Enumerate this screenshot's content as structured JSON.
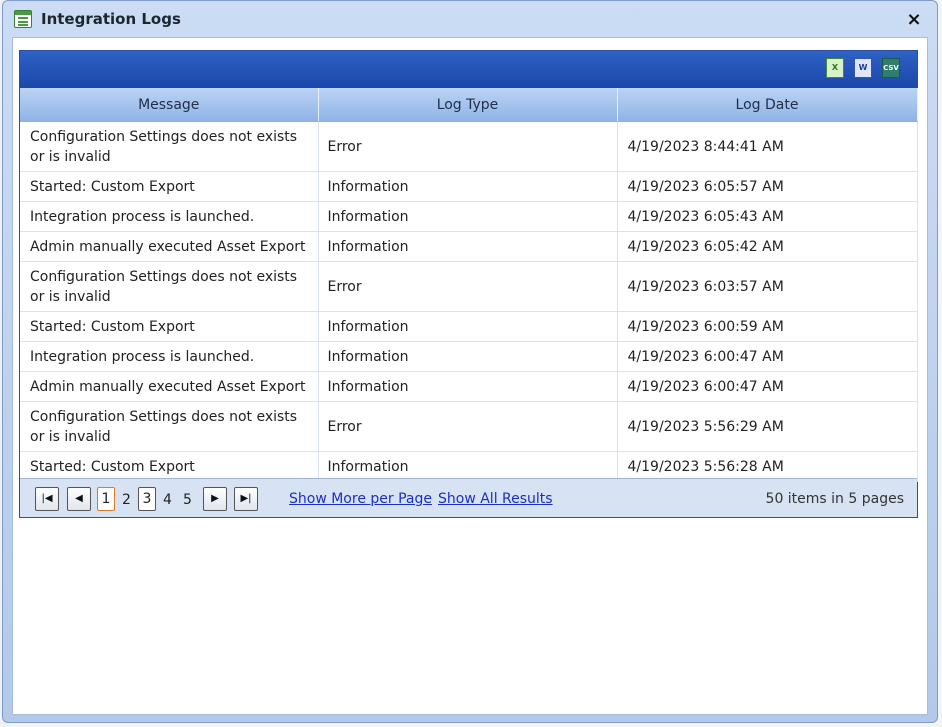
{
  "window": {
    "title": "Integration Logs",
    "close_label": "×"
  },
  "toolbar": {
    "icons": [
      "excel-export-icon",
      "word-export-icon",
      "csv-export-icon"
    ],
    "excel_label": "X",
    "word_label": "W",
    "csv_label": "CSV"
  },
  "columns": [
    "Message",
    "Log Type",
    "Log Date"
  ],
  "rows": [
    {
      "message": "Configuration Settings does not exists or is invalid",
      "type": "Error",
      "date": "4/19/2023 8:44:41 AM"
    },
    {
      "message": "Started: Custom Export",
      "type": "Information",
      "date": "4/19/2023 6:05:57 AM"
    },
    {
      "message": "Integration process is launched.",
      "type": "Information",
      "date": "4/19/2023 6:05:43 AM"
    },
    {
      "message": "Admin manually executed Asset Export",
      "type": "Information",
      "date": "4/19/2023 6:05:42 AM"
    },
    {
      "message": "Configuration Settings does not exists or is invalid",
      "type": "Error",
      "date": "4/19/2023 6:03:57 AM"
    },
    {
      "message": "Started: Custom Export",
      "type": "Information",
      "date": "4/19/2023 6:00:59 AM"
    },
    {
      "message": "Integration process is launched.",
      "type": "Information",
      "date": "4/19/2023 6:00:47 AM"
    },
    {
      "message": "Admin manually executed Asset Export",
      "type": "Information",
      "date": "4/19/2023 6:00:47 AM"
    },
    {
      "message": "Configuration Settings does not exists or is invalid",
      "type": "Error",
      "date": "4/19/2023 5:56:29 AM"
    },
    {
      "message": "Started: Custom Export",
      "type": "Information",
      "date": "4/19/2023 5:56:28 AM"
    }
  ],
  "pager": {
    "pages": [
      "1",
      "2",
      "3",
      "4",
      "5"
    ],
    "current_page": "1",
    "show_more": "Show More per Page",
    "show_all": "Show All Results",
    "summary": "50 items in 5 pages"
  },
  "colors": {
    "header_bar": "#1a47a8",
    "current_page_border": "#e07b2a",
    "link": "#1830c6"
  }
}
